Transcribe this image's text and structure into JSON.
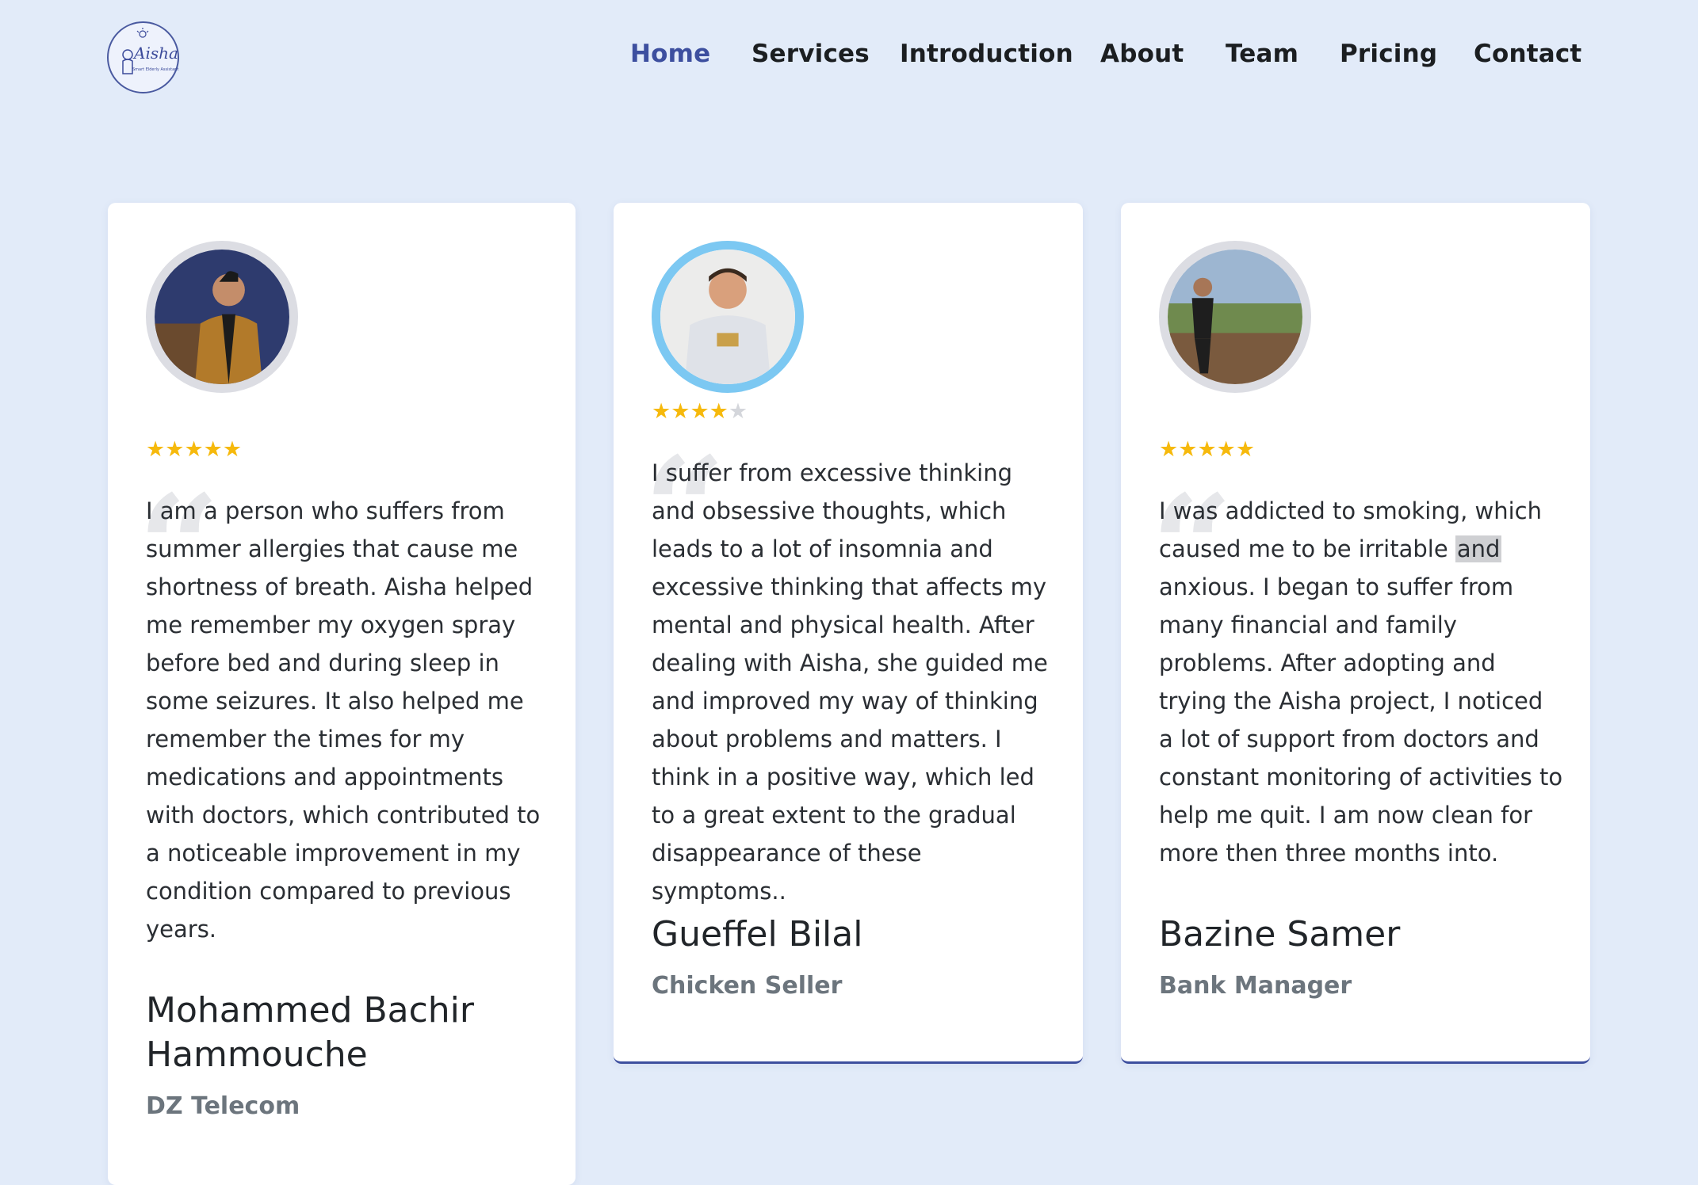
{
  "brand": {
    "logo_text": "Aisha",
    "logo_subtitle": "Smart Elderly Assistant",
    "accent_color": "#3d4f9f",
    "star_color": "#f6b90c"
  },
  "nav": {
    "items": [
      {
        "label": "Home",
        "active": true
      },
      {
        "label": "Services",
        "active": false
      },
      {
        "label": "Introduction",
        "active": false
      },
      {
        "label": "About",
        "active": false
      },
      {
        "label": "Team",
        "active": false
      },
      {
        "label": "Pricing",
        "active": false
      },
      {
        "label": "Contact",
        "active": false
      }
    ]
  },
  "testimonials": [
    {
      "rating": 5,
      "max_rating": 5,
      "quote_mark": "“",
      "text": "I am a person who suffers from summer allergies that cause me shortness of breath. Aisha helped me remember my oxygen spray before bed and during sleep in some seizures. It also helped me remember the times for my medications and appointments with doctors, which contributed to a noticeable improvement in my condition compared to previous years.",
      "name": "Mohammed Bachir Hammouche",
      "role": "DZ Telecom",
      "avatar_icon": "person-avatar"
    },
    {
      "rating": 4,
      "max_rating": 5,
      "quote_mark": "“",
      "text": "I suffer from excessive thinking and obsessive thoughts, which leads to a lot of insomnia and excessive thinking that affects my mental and physical health. After dealing with Aisha, she guided me and improved my way of thinking about problems and matters. I think in a positive way, which led to a great extent to the gradual disappearance of these symptoms..",
      "name": "Gueffel Bilal",
      "role": "Chicken Seller",
      "avatar_icon": "person-avatar"
    },
    {
      "rating": 5,
      "max_rating": 5,
      "quote_mark": "“",
      "text_before": "I was addicted to smoking, which caused me to be irritable ",
      "text_highlight": "and",
      "text_after": " anxious. I began to suffer from many financial and family problems. After adopting and trying the Aisha project, I noticed a lot of support from doctors and constant monitoring of activities to help me quit. I am now clean for more then three months into.",
      "name": "Bazine Samer",
      "role": "Bank Manager",
      "avatar_icon": "person-avatar"
    }
  ]
}
